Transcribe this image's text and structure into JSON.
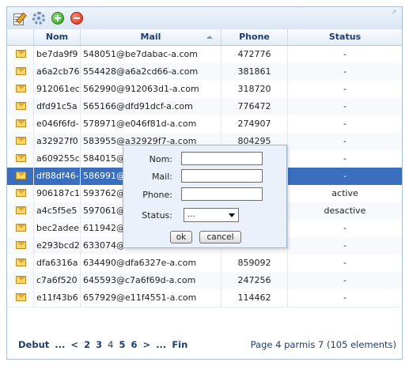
{
  "toolbar": {
    "icons": [
      "edit-icon",
      "settings-icon",
      "add-icon",
      "delete-icon"
    ]
  },
  "table": {
    "columns": [
      "Nom",
      "Mail",
      "Phone",
      "Status"
    ],
    "sort_column": "Mail",
    "rows": [
      {
        "nom": "be7da9f9",
        "mail": "548051@be7dabac-a.com",
        "phone": "472776",
        "status": "-"
      },
      {
        "nom": "a6a2cb76",
        "mail": "554428@a6a2cd66-a.com",
        "phone": "381861",
        "status": "-"
      },
      {
        "nom": "912061ec",
        "mail": "562990@912063d1-a.com",
        "phone": "318720",
        "status": "-"
      },
      {
        "nom": "dfd91c5a",
        "mail": "565166@dfd91dcf-a.com",
        "phone": "776472",
        "status": "-"
      },
      {
        "nom": "e046f6fd-",
        "mail": "578971@e046f81d-a.com",
        "phone": "274907",
        "status": "-"
      },
      {
        "nom": "a32927f0",
        "mail": "583955@a32929f7-a.com",
        "phone": "804295",
        "status": "-"
      },
      {
        "nom": "a609255c",
        "mail": "584015@",
        "phone": "",
        "status": "-"
      },
      {
        "nom": "df88df46-",
        "mail": "586991@",
        "phone": "",
        "status": "-"
      },
      {
        "nom": "906187c1",
        "mail": "593762@",
        "phone": "",
        "status": "active"
      },
      {
        "nom": "a4c5f5e5",
        "mail": "597061@",
        "phone": "",
        "status": "desactive"
      },
      {
        "nom": "bec2adee",
        "mail": "611942@",
        "phone": "",
        "status": "-"
      },
      {
        "nom": "e293bcd2",
        "mail": "633074@",
        "phone": "",
        "status": "-"
      },
      {
        "nom": "dfa6316a",
        "mail": "634490@dfa6327e-a.com",
        "phone": "859092",
        "status": "-"
      },
      {
        "nom": "c7a6f520",
        "mail": "645593@c7a6f69d-a.com",
        "phone": "247256",
        "status": "-"
      },
      {
        "nom": "e11f43b6",
        "mail": "657929@e11f4551-a.com",
        "phone": "114462",
        "status": "-"
      }
    ],
    "selected_row_index": 7
  },
  "pager": {
    "first": "Debut",
    "ellipsis_left": "...",
    "prev": "<",
    "pages": [
      "2",
      "3",
      "4",
      "5",
      "6"
    ],
    "current_page": "4",
    "next": ">",
    "ellipsis_right": "...",
    "last": "Fin",
    "info": "Page 4 parmis 7 (105 elements)"
  },
  "dialog": {
    "nom_label": "Nom:",
    "mail_label": "Mail:",
    "phone_label": "Phone:",
    "status_label": "Status:",
    "status_value": "...",
    "ok_label": "ok",
    "cancel_label": "cancel"
  },
  "colors": {
    "selected_row": "#3a6fc0",
    "header_text": "#1e3f6e"
  }
}
